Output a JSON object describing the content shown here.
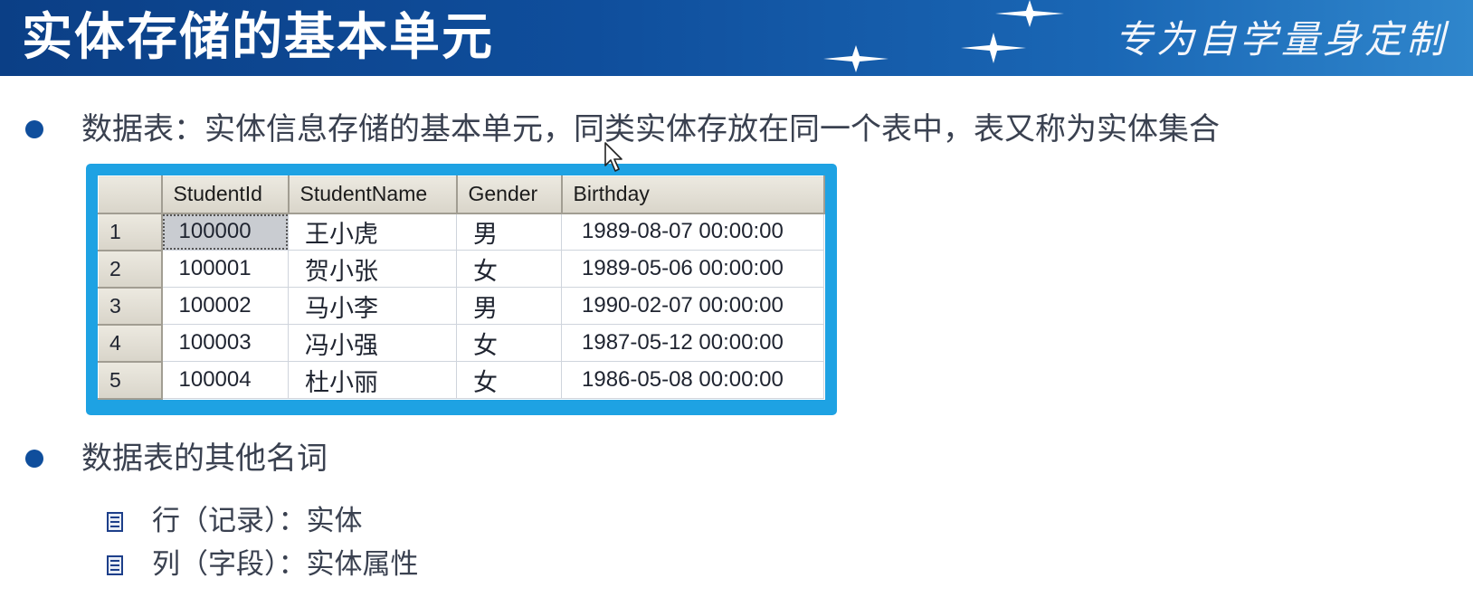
{
  "header": {
    "title": "实体存储的基本单元",
    "slogan": "专为自学量身定制"
  },
  "bullets": [
    {
      "text": "数据表：实体信息存储的基本单元，同类实体存放在同一个表中，表又称为实体集合"
    },
    {
      "text": "数据表的其他名词"
    }
  ],
  "sub_items": [
    {
      "text": "行（记录）：实体"
    },
    {
      "text": "列（字段）：实体属性"
    }
  ],
  "table": {
    "columns": [
      "",
      "StudentId",
      "StudentName",
      "Gender",
      "Birthday"
    ],
    "rows": [
      {
        "num": "1",
        "id": "100000",
        "name": "王小虎",
        "gender": "男",
        "birthday": "1989-08-07 00:00:00"
      },
      {
        "num": "2",
        "id": "100001",
        "name": "贺小张",
        "gender": "女",
        "birthday": "1989-05-06 00:00:00"
      },
      {
        "num": "3",
        "id": "100002",
        "name": "马小李",
        "gender": "男",
        "birthday": "1990-02-07 00:00:00"
      },
      {
        "num": "4",
        "id": "100003",
        "name": "冯小强",
        "gender": "女",
        "birthday": "1987-05-12 00:00:00"
      },
      {
        "num": "5",
        "id": "100004",
        "name": "杜小丽",
        "gender": "女",
        "birthday": "1986-05-08 00:00:00"
      }
    ]
  },
  "colors": {
    "banner": "#0f4e9c",
    "bullet": "#0f4e9c",
    "table_frame": "#1ea2e3",
    "header_cell": "#ece9e0"
  },
  "icons": [
    "star-icon",
    "bullet-dot-icon",
    "list-square-icon",
    "mouse-cursor-icon"
  ]
}
